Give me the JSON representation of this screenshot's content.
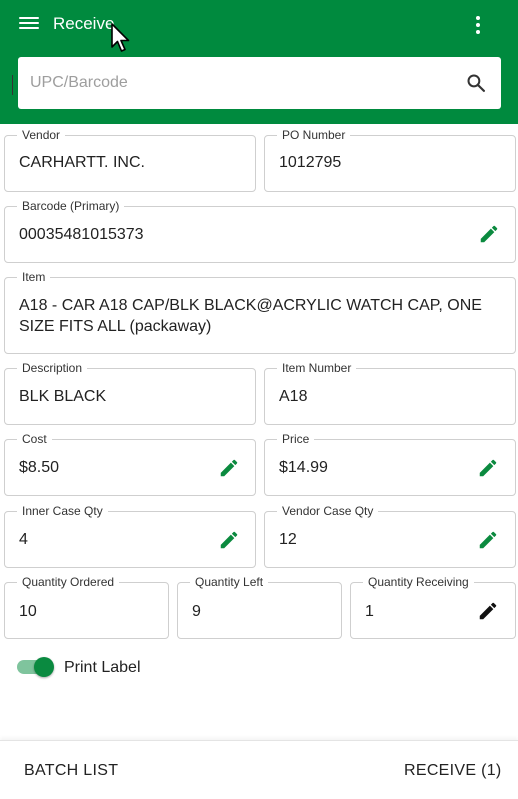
{
  "app_bar": {
    "title": "Receive",
    "menu_icon": "hamburger-menu-icon",
    "overflow_icon": "more-vert-icon",
    "color": "#008a3e"
  },
  "search": {
    "placeholder": "UPC/Barcode",
    "value": "",
    "icon": "search-icon"
  },
  "fields": {
    "vendor": {
      "label": "Vendor",
      "value": "CARHARTT. INC."
    },
    "po_number": {
      "label": "PO Number",
      "value": "1012795"
    },
    "barcode": {
      "label": "Barcode (Primary)",
      "value": "00035481015373"
    },
    "item": {
      "label": "Item",
      "value": "A18 - CAR A18 CAP/BLK BLACK@ACRYLIC WATCH CAP, ONE SIZE FITS ALL (packaway)"
    },
    "description": {
      "label": "Description",
      "value": "BLK BLACK"
    },
    "item_number": {
      "label": "Item Number",
      "value": "A18"
    },
    "cost": {
      "label": "Cost",
      "value": "$8.50"
    },
    "price": {
      "label": "Price",
      "value": "$14.99"
    },
    "inner_case_qty": {
      "label": "Inner Case Qty",
      "value": "4"
    },
    "vendor_case_qty": {
      "label": "Vendor Case Qty",
      "value": "12"
    },
    "quantity_ordered": {
      "label": "Quantity Ordered",
      "value": "10"
    },
    "quantity_left": {
      "label": "Quantity Left",
      "value": "9"
    },
    "quantity_receiving": {
      "label": "Quantity Receiving",
      "value": "1"
    }
  },
  "print_label": {
    "label": "Print Label",
    "enabled": true
  },
  "bottom_bar": {
    "batch_list": "BATCH LIST",
    "receive": "RECEIVE (1)"
  },
  "colors": {
    "accent": "#008a3e",
    "edit_icon": "#0b8a3f",
    "edit_icon_active": "#111111"
  }
}
